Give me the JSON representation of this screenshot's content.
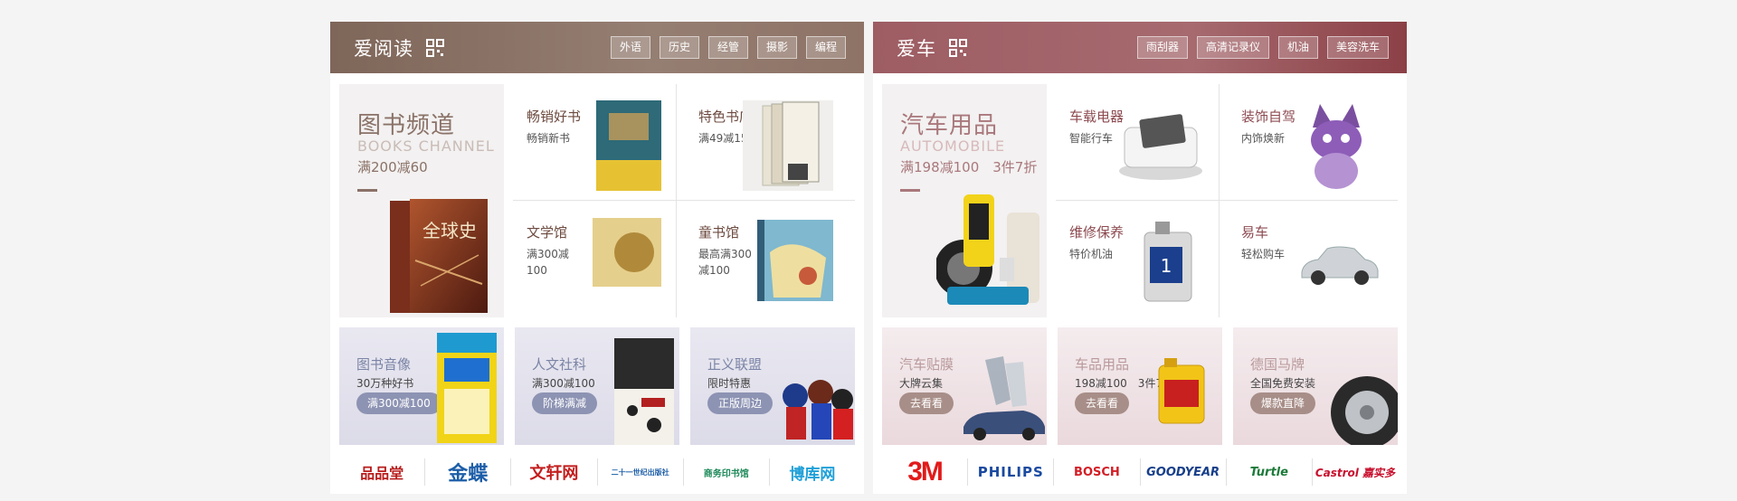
{
  "book": {
    "title": "爱阅读",
    "tags": [
      "外语",
      "历史",
      "经管",
      "摄影",
      "编程"
    ],
    "feature": {
      "title": "图书频道",
      "en": "BOOKS CHANNEL",
      "promo": "满200减60",
      "book_title": "全球史"
    },
    "cells": [
      {
        "title": "畅销好书",
        "sub": "畅销新书"
      },
      {
        "title": "特色书店",
        "sub": "满49减15"
      },
      {
        "title": "文学馆",
        "sub": "满300减100"
      },
      {
        "title": "童书馆",
        "sub": "最高满300减100"
      }
    ],
    "promos": [
      {
        "title": "图书音像",
        "sub": "30万种好书",
        "btn": "满300减100"
      },
      {
        "title": "人文社科",
        "sub": "满300减100",
        "btn": "阶梯满减"
      },
      {
        "title": "正义联盟",
        "sub": "限时特惠",
        "btn": "正版周边"
      }
    ],
    "brands": [
      "品品堂",
      "金蝶",
      "文轩网",
      "二十一世纪出版社",
      "商务印书馆",
      "博库网"
    ]
  },
  "car": {
    "title": "爱车",
    "tags": [
      "雨刮器",
      "高清记录仪",
      "机油",
      "美容洗车"
    ],
    "feature": {
      "title": "汽车用品",
      "en": "AUTOMOBILE",
      "promo": "满198减100　3件7折"
    },
    "cells": [
      {
        "title": "车载电器",
        "sub": "智能行车"
      },
      {
        "title": "装饰自驾",
        "sub": "内饰焕新"
      },
      {
        "title": "维修保养",
        "sub": "特价机油"
      },
      {
        "title": "易车",
        "sub": "轻松购车"
      }
    ],
    "promos": [
      {
        "title": "汽车贴膜",
        "sub": "大牌云集",
        "btn": "去看看"
      },
      {
        "title": "车品用品",
        "sub": "198减100　3件7折",
        "btn": "去看看"
      },
      {
        "title": "德国马牌",
        "sub": "全国免费安装",
        "btn": "爆款直降"
      }
    ],
    "brands": [
      "3M",
      "PHILIPS",
      "BOSCH",
      "GOODYEAR",
      "Turtle",
      "Castrol 嘉实多"
    ]
  }
}
